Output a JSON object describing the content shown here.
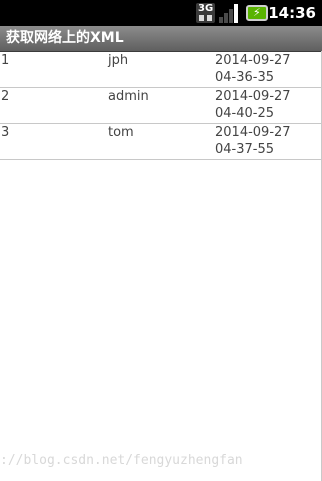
{
  "status_bar": {
    "network_type": "3G",
    "network_icon": "3g-icon",
    "signal_icon": "signal-strength-icon",
    "battery_icon": "battery-charging-icon",
    "battery_color": "#59b300",
    "battery_bolt": "⚡",
    "time": "14:36"
  },
  "app": {
    "title": "获取网络上的XML"
  },
  "list": {
    "rows": [
      {
        "id": "1",
        "name": "jph",
        "date": "2014-09-27",
        "time": "04-36-35"
      },
      {
        "id": "2",
        "name": "admin",
        "date": "2014-09-27",
        "time": "04-40-25"
      },
      {
        "id": "3",
        "name": "tom",
        "date": "2014-09-27",
        "time": "04-37-55"
      }
    ]
  },
  "watermark": {
    "text": "://blog.csdn.net/fengyuzhengfan"
  }
}
